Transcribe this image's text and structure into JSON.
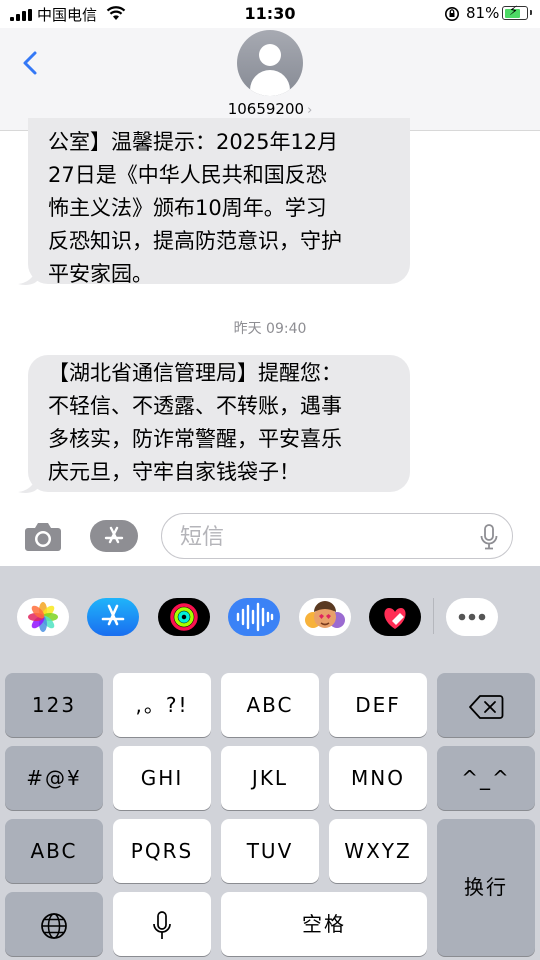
{
  "status_bar": {
    "carrier": "中国电信",
    "time": "11:30",
    "battery_percent": "81%",
    "battery_level": 0.81,
    "battery_color": "#4cd964"
  },
  "header": {
    "back_icon": "chevron-left-icon",
    "contact_number": "10659200",
    "accent_color": "#3478f6"
  },
  "messages": [
    {
      "lines": [
        "公室】温馨提示：2025年12月",
        "27日是《中华人民共和国反恐",
        "怖主义法》颁布10周年。学习",
        "反恐知识，提高防范意识，守护",
        "平安家园。"
      ]
    },
    {
      "timestamp_day": "昨天",
      "timestamp_time": "09:40",
      "lines": [
        "【湖北省通信管理局】提醒您：",
        "不轻信、不透露、不转账，遇事",
        "多核实，防诈常警醒，平安喜乐",
        "庆元旦，守牢自家钱袋子！"
      ]
    }
  ],
  "input": {
    "placeholder": "短信"
  },
  "app_strip": [
    "photos-icon",
    "app-store-icon",
    "activity-icon",
    "audio-message-icon",
    "memoji-icon",
    "digital-touch-icon",
    "more-icon"
  ],
  "keyboard": {
    "row1": [
      "123",
      ",。?!",
      "ABC",
      "DEF"
    ],
    "row2": [
      "#@¥",
      "GHI",
      "JKL",
      "MNO",
      "^_^"
    ],
    "row3": [
      "ABC",
      "PQRS",
      "TUV",
      "WXYZ"
    ],
    "space": "空格",
    "return": "换行"
  }
}
